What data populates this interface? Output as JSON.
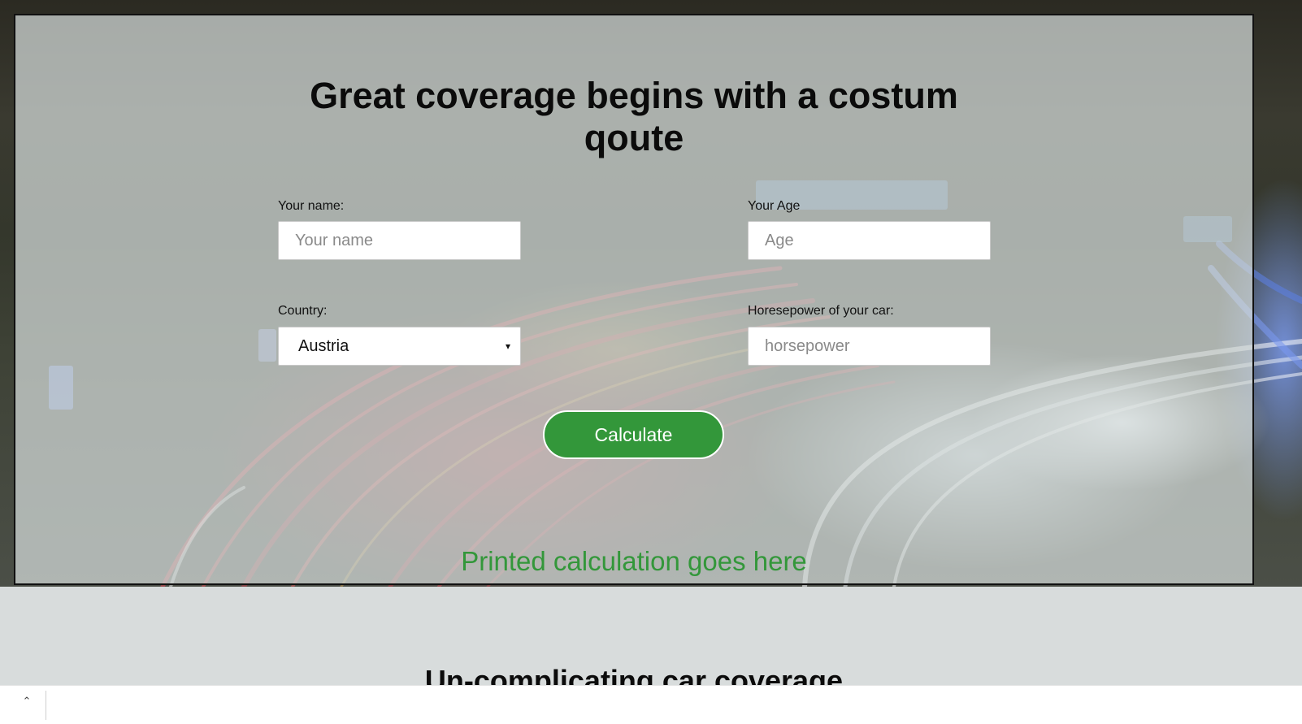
{
  "hero": {
    "title": "Great coverage begins with a costum qoute"
  },
  "form": {
    "name_label": "Your name:",
    "name_placeholder": "Your name",
    "age_label": "Your Age",
    "age_placeholder": "Age",
    "country_label": "Country:",
    "country_value": "Austria",
    "horsepower_label": "Horesepower of your car:",
    "horsepower_placeholder": "horsepower",
    "calculate_label": "Calculate"
  },
  "result": {
    "text": "Printed calculation goes here"
  },
  "section2": {
    "title": "Un-complicating car coverage"
  },
  "bottom_bar": {
    "collapse_icon": "chevron-up-icon"
  },
  "colors": {
    "accent_green": "#33973a",
    "overlay": "#d7dedc"
  }
}
